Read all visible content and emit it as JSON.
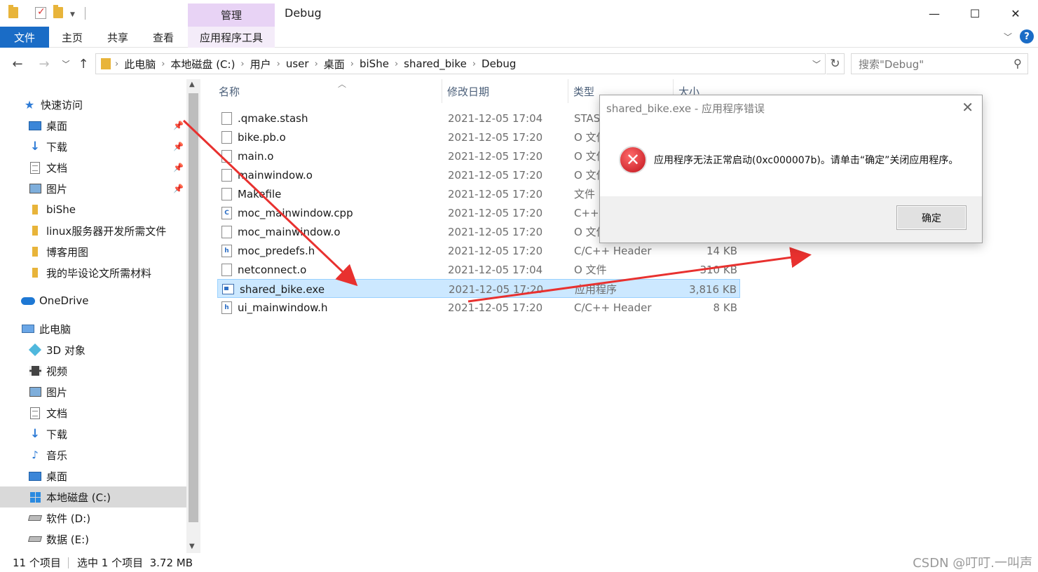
{
  "window": {
    "title": "Debug",
    "manage_tab": "管理",
    "controls": {
      "minimize": "—",
      "maximize": "☐",
      "close": "✕"
    }
  },
  "ribbon": {
    "tabs": [
      "文件",
      "主页",
      "共享",
      "查看",
      "应用程序工具"
    ]
  },
  "address": {
    "crumbs": [
      "此电脑",
      "本地磁盘 (C:)",
      "用户",
      "user",
      "桌面",
      "biShe",
      "shared_bike",
      "Debug"
    ],
    "search_placeholder": "搜索\"Debug\""
  },
  "sidebar": {
    "items": [
      {
        "label": "快速访问",
        "icon": "star-icon"
      },
      {
        "label": "桌面",
        "icon": "desktop-icon",
        "pinned": true
      },
      {
        "label": "下载",
        "icon": "download-icon",
        "pinned": true
      },
      {
        "label": "文档",
        "icon": "document-icon",
        "pinned": true
      },
      {
        "label": "图片",
        "icon": "pictures-icon",
        "pinned": true
      },
      {
        "label": "biShe",
        "icon": "folder-icon"
      },
      {
        "label": "linux服务器开发所需文件",
        "icon": "folder-icon"
      },
      {
        "label": "博客用图",
        "icon": "folder-icon"
      },
      {
        "label": "我的毕设论文所需材料",
        "icon": "folder-icon"
      },
      {
        "label": "OneDrive",
        "icon": "onedrive-icon"
      },
      {
        "label": "此电脑",
        "icon": "this-pc-icon"
      },
      {
        "label": "3D 对象",
        "icon": "3d-objects-icon"
      },
      {
        "label": "视频",
        "icon": "video-icon"
      },
      {
        "label": "图片",
        "icon": "pictures-icon"
      },
      {
        "label": "文档",
        "icon": "document-icon"
      },
      {
        "label": "下载",
        "icon": "download-icon"
      },
      {
        "label": "音乐",
        "icon": "music-icon"
      },
      {
        "label": "桌面",
        "icon": "desktop-icon"
      },
      {
        "label": "本地磁盘 (C:)",
        "icon": "windows-drive-icon",
        "selected": true
      },
      {
        "label": "软件 (D:)",
        "icon": "drive-icon"
      },
      {
        "label": "数据 (E:)",
        "icon": "drive-icon"
      }
    ]
  },
  "filelist": {
    "headers": {
      "name": "名称",
      "date": "修改日期",
      "type": "类型",
      "size": "大小"
    },
    "rows": [
      {
        "name": ".qmake.stash",
        "date": "2021-12-05 17:04",
        "type": "STASH",
        "size": "",
        "icon": "file-icon"
      },
      {
        "name": "bike.pb.o",
        "date": "2021-12-05 17:20",
        "type": "O 文件",
        "size": "",
        "icon": "file-icon"
      },
      {
        "name": "main.o",
        "date": "2021-12-05 17:20",
        "type": "O 文件",
        "size": "",
        "icon": "file-icon"
      },
      {
        "name": "mainwindow.o",
        "date": "2021-12-05 17:20",
        "type": "O 文件",
        "size": "",
        "icon": "file-icon"
      },
      {
        "name": "Makefile",
        "date": "2021-12-05 17:20",
        "type": "文件",
        "size": "",
        "icon": "file-icon"
      },
      {
        "name": "moc_mainwindow.cpp",
        "date": "2021-12-05 17:20",
        "type": "C++",
        "size": "",
        "icon": "cpp-file-icon"
      },
      {
        "name": "moc_mainwindow.o",
        "date": "2021-12-05 17:20",
        "type": "O 文件",
        "size": "",
        "icon": "file-icon"
      },
      {
        "name": "moc_predefs.h",
        "date": "2021-12-05 17:20",
        "type": "C/C++ Header",
        "size": "14 KB",
        "icon": "header-file-icon"
      },
      {
        "name": "netconnect.o",
        "date": "2021-12-05 17:04",
        "type": "O 文件",
        "size": "310 KB",
        "icon": "file-icon"
      },
      {
        "name": "shared_bike.exe",
        "date": "2021-12-05 17:20",
        "type": "应用程序",
        "size": "3,816 KB",
        "icon": "exe-file-icon",
        "selected": true
      },
      {
        "name": "ui_mainwindow.h",
        "date": "2021-12-05 17:20",
        "type": "C/C++ Header",
        "size": "8 KB",
        "icon": "header-file-icon"
      }
    ]
  },
  "statusbar": {
    "count": "11 个项目",
    "selection": "选中 1 个项目  3.72 MB",
    "watermark": "CSDN @叮叮.一叫声"
  },
  "dialog": {
    "title": "shared_bike.exe - 应用程序错误",
    "message": "应用程序无法正常启动(0xc000007b)。请单击“确定”关闭应用程序。",
    "ok_label": "确定"
  },
  "colors": {
    "accent": "#1a6cc6",
    "selection_bg": "#cce8ff",
    "manage_tab_bg": "#e8d3f5",
    "arrow": "#e8312f"
  }
}
